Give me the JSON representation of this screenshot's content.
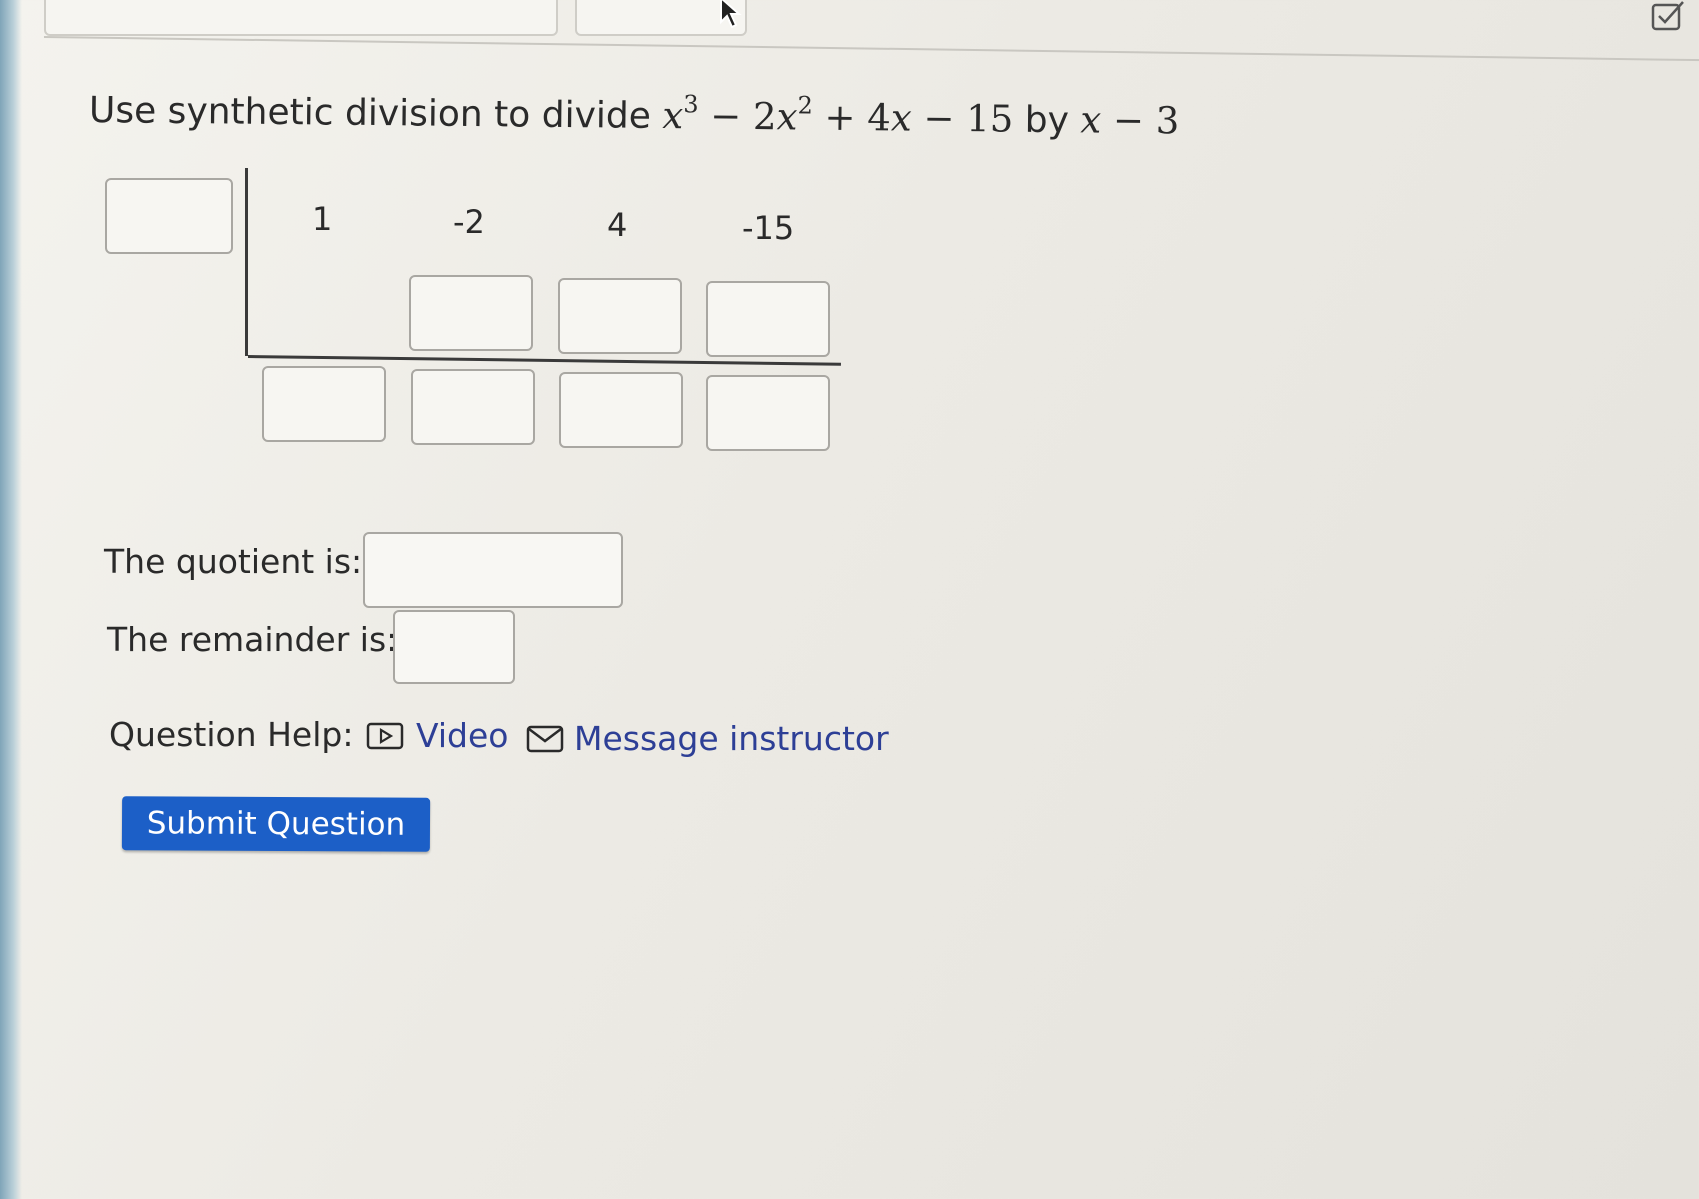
{
  "question": {
    "prefix": "Use synthetic division to divide",
    "dividend": {
      "t1_var": "x",
      "t1_exp": "3",
      "op1": " − 2",
      "t2_var": "x",
      "t2_exp": "2",
      "op2": " + 4",
      "t3_var": "x",
      "op3": " − 15"
    },
    "connector": "by",
    "divisor": {
      "var": "x",
      "rest": " − 3"
    }
  },
  "synthetic_division": {
    "coefficients": [
      "1",
      "-2",
      "4",
      "-15"
    ],
    "divisor_value": "",
    "middle_row": [
      "",
      "",
      ""
    ],
    "bottom_row": [
      "",
      "",
      "",
      ""
    ]
  },
  "answers": {
    "quotient_label": "The quotient is:",
    "quotient_value": "",
    "remainder_label": "The remainder is:",
    "remainder_value": ""
  },
  "help": {
    "label": "Question Help:",
    "video_label": "Video",
    "video_icon": "video-play-icon",
    "message_label": "Message instructor",
    "message_icon": "envelope-icon"
  },
  "submit_label": "Submit Question",
  "colors": {
    "link": "#2d3f96",
    "button": "#1c5fc7"
  }
}
